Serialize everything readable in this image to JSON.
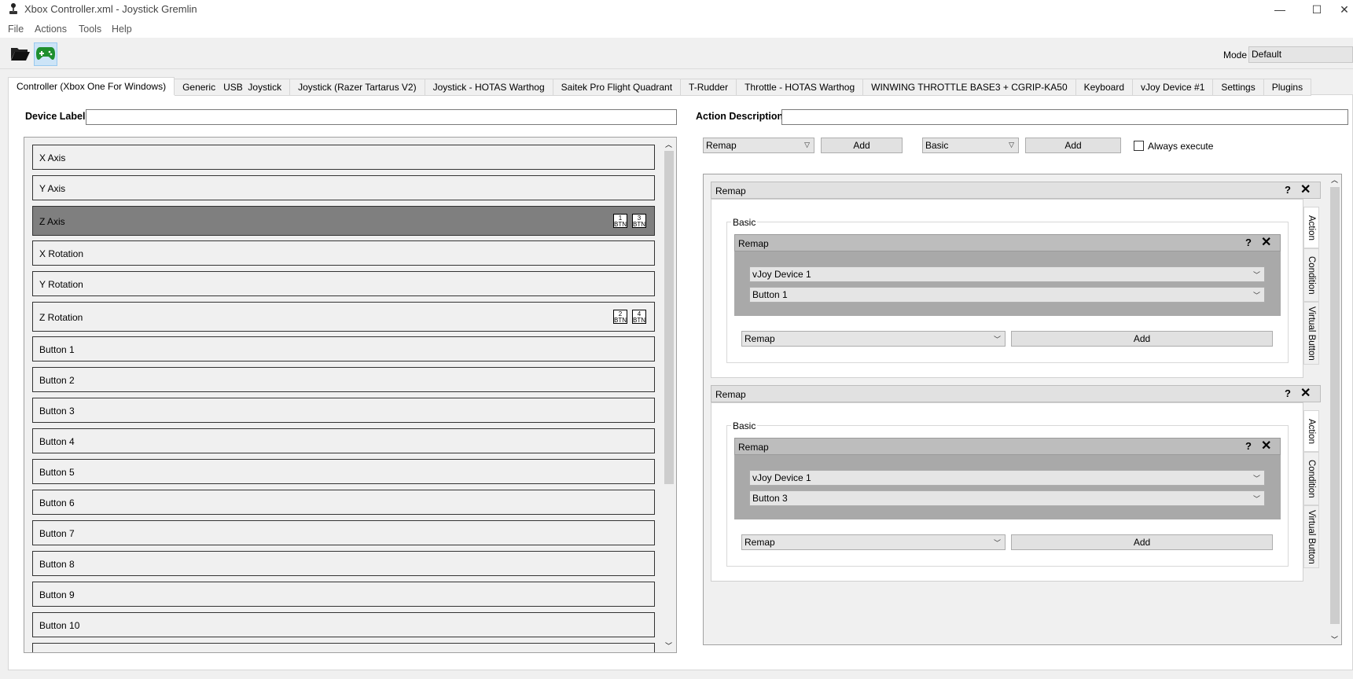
{
  "window": {
    "title": "Xbox Controller.xml - Joystick Gremlin",
    "controls": {
      "minimize": "—",
      "maximize": "☐",
      "close": "✕"
    }
  },
  "menu": [
    "File",
    "Actions",
    "Tools",
    "Help"
  ],
  "toolbar": {
    "open_icon": "folder-open-icon",
    "device_icon": "gamepad-icon",
    "mode_label": "Mode",
    "mode_value": "Default"
  },
  "tabs": [
    "Controller (Xbox One For Windows)",
    "Generic   USB  Joystick",
    "Joystick (Razer Tartarus V2)",
    "Joystick - HOTAS Warthog",
    "Saitek Pro Flight Quadrant",
    "T-Rudder",
    "Throttle - HOTAS Warthog",
    "WINWING THROTTLE BASE3 + CGRIP-KA50",
    "Keyboard",
    "vJoy Device #1",
    "Settings",
    "Plugins"
  ],
  "device_label": {
    "label": "Device Label",
    "value": ""
  },
  "action_description": {
    "label": "Action Description",
    "value": ""
  },
  "inputs": [
    {
      "label": "X Axis",
      "badges": []
    },
    {
      "label": "Y Axis",
      "badges": []
    },
    {
      "label": "Z Axis",
      "badges": [
        [
          "1",
          "BTN"
        ],
        [
          "3",
          "BTN"
        ]
      ],
      "selected": true
    },
    {
      "label": "X Rotation",
      "badges": []
    },
    {
      "label": "Y Rotation",
      "badges": []
    },
    {
      "label": "Z Rotation",
      "badges": [
        [
          "2",
          "BTN"
        ],
        [
          "4",
          "BTN"
        ]
      ]
    },
    {
      "label": "Button 1",
      "badges": []
    },
    {
      "label": "Button 2",
      "badges": []
    },
    {
      "label": "Button 3",
      "badges": []
    },
    {
      "label": "Button 4",
      "badges": []
    },
    {
      "label": "Button 5",
      "badges": []
    },
    {
      "label": "Button 6",
      "badges": []
    },
    {
      "label": "Button 7",
      "badges": []
    },
    {
      "label": "Button 8",
      "badges": []
    },
    {
      "label": "Button 9",
      "badges": []
    },
    {
      "label": "Button 10",
      "badges": []
    }
  ],
  "action_toolbar": {
    "action_combo": "Remap",
    "add_action": "Add",
    "container_combo": "Basic",
    "add_container": "Add",
    "always_execute": "Always execute"
  },
  "containers": [
    {
      "header": "Remap",
      "help": "?",
      "group": "Basic",
      "inner_header": "Remap",
      "device": "vJoy Device 1",
      "output": "Button 1",
      "add_combo": "Remap",
      "add_button": "Add",
      "vtabs": [
        "Action",
        "Condition",
        "Virtual Button"
      ]
    },
    {
      "header": "Remap",
      "help": "?",
      "group": "Basic",
      "inner_header": "Remap",
      "device": "vJoy Device 1",
      "output": "Button 3",
      "add_combo": "Remap",
      "add_button": "Add",
      "vtabs": [
        "Action",
        "Condition",
        "Virtual Button"
      ]
    }
  ]
}
